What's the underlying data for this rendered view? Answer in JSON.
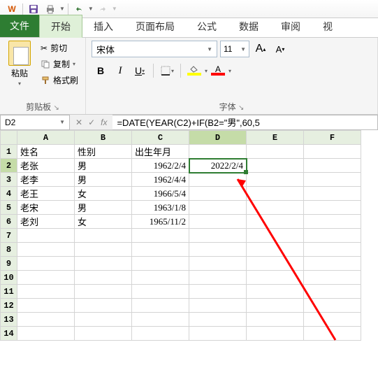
{
  "qat": {
    "wps_label": "W"
  },
  "tabs": {
    "file": "文件",
    "home": "开始",
    "insert": "插入",
    "layout": "页面布局",
    "formula": "公式",
    "data": "数据",
    "review": "审阅",
    "view": "视"
  },
  "ribbon": {
    "clipboard": {
      "paste": "粘贴",
      "cut": "剪切",
      "copy": "复制",
      "format_painter": "格式刷",
      "group_label": "剪贴板"
    },
    "font": {
      "name": "宋体",
      "size": "11",
      "increase_a": "A",
      "decrease_a": "A",
      "bold": "B",
      "italic": "I",
      "underline": "U",
      "font_char": "A",
      "group_label": "字体"
    }
  },
  "selection": {
    "name_box": "D2",
    "formula": "=DATE(YEAR(C2)+IF(B2=\"男\",60,5"
  },
  "grid": {
    "cols": [
      "A",
      "B",
      "C",
      "D",
      "E",
      "F"
    ],
    "headers": {
      "A": "姓名",
      "B": "性别",
      "C": "出生年月"
    },
    "rows": [
      {
        "n": 1,
        "A": "姓名",
        "B": "性别",
        "C": "出生年月",
        "D": ""
      },
      {
        "n": 2,
        "A": "老张",
        "B": "男",
        "C": "1962/2/4",
        "D": "2022/2/4"
      },
      {
        "n": 3,
        "A": "老李",
        "B": "男",
        "C": "1962/4/4",
        "D": ""
      },
      {
        "n": 4,
        "A": "老王",
        "B": "女",
        "C": "1966/5/4",
        "D": ""
      },
      {
        "n": 5,
        "A": "老宋",
        "B": "男",
        "C": "1963/1/8",
        "D": ""
      },
      {
        "n": 6,
        "A": "老刘",
        "B": "女",
        "C": "1965/11/2",
        "D": ""
      }
    ],
    "active_col": "D",
    "active_row": 2
  }
}
